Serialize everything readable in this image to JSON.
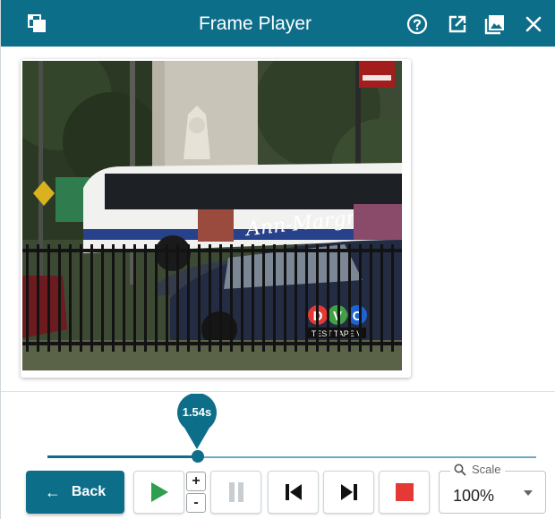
{
  "header": {
    "title": "Frame Player",
    "icons": [
      "layers-icon",
      "help-icon",
      "popout-icon",
      "snapshot-icon",
      "close-icon"
    ],
    "color": "#0d6e89"
  },
  "video": {
    "overlay_text": "Ann-Margret",
    "logo_letters": [
      "D",
      "V",
      "C"
    ],
    "logo_caption": "TEST TAPE V"
  },
  "timeline": {
    "current_time": "1.54s",
    "progress": 0.31
  },
  "controls": {
    "back_label": "Back",
    "play_icon": "play-icon",
    "pause_icon": "pause-icon",
    "prev_icon": "skip-previous-icon",
    "next_icon": "skip-next-icon",
    "stop_icon": "stop-icon",
    "plus_label": "+",
    "minus_label": "-",
    "play_color": "#2e9e4f",
    "stop_color": "#e53935"
  },
  "scale": {
    "label": "Scale",
    "value": "100%"
  }
}
